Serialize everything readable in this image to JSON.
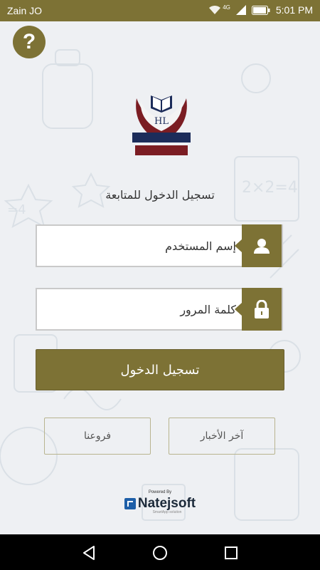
{
  "status_bar": {
    "carrier": "Zain JO",
    "network": "4G",
    "time": "5:01 PM",
    "icons": [
      "wifi-icon",
      "signal-icon",
      "battery-icon"
    ]
  },
  "help": {
    "label": "?",
    "icon": "question-icon"
  },
  "logo": {
    "monogram": "HL",
    "alt_text": "High Level Academy"
  },
  "login": {
    "subtitle": "تسجيل الدخول للمتابعة",
    "username_placeholder": "إسم المستخدم",
    "password_placeholder": "كلمة المرور",
    "submit_label": "تسجيل الدخول"
  },
  "secondary_buttons": {
    "news_label": "آخر الأخبار",
    "branches_label": "فروعنا"
  },
  "footer": {
    "powered_by": "Powered By",
    "brand": "Natejsoft",
    "tagline": "SmartApp solution"
  },
  "colors": {
    "accent": "#7d7235",
    "background": "#eef0f3",
    "navbar": "#000000"
  },
  "navbar_icons": [
    "back-icon",
    "home-icon",
    "recents-icon"
  ]
}
